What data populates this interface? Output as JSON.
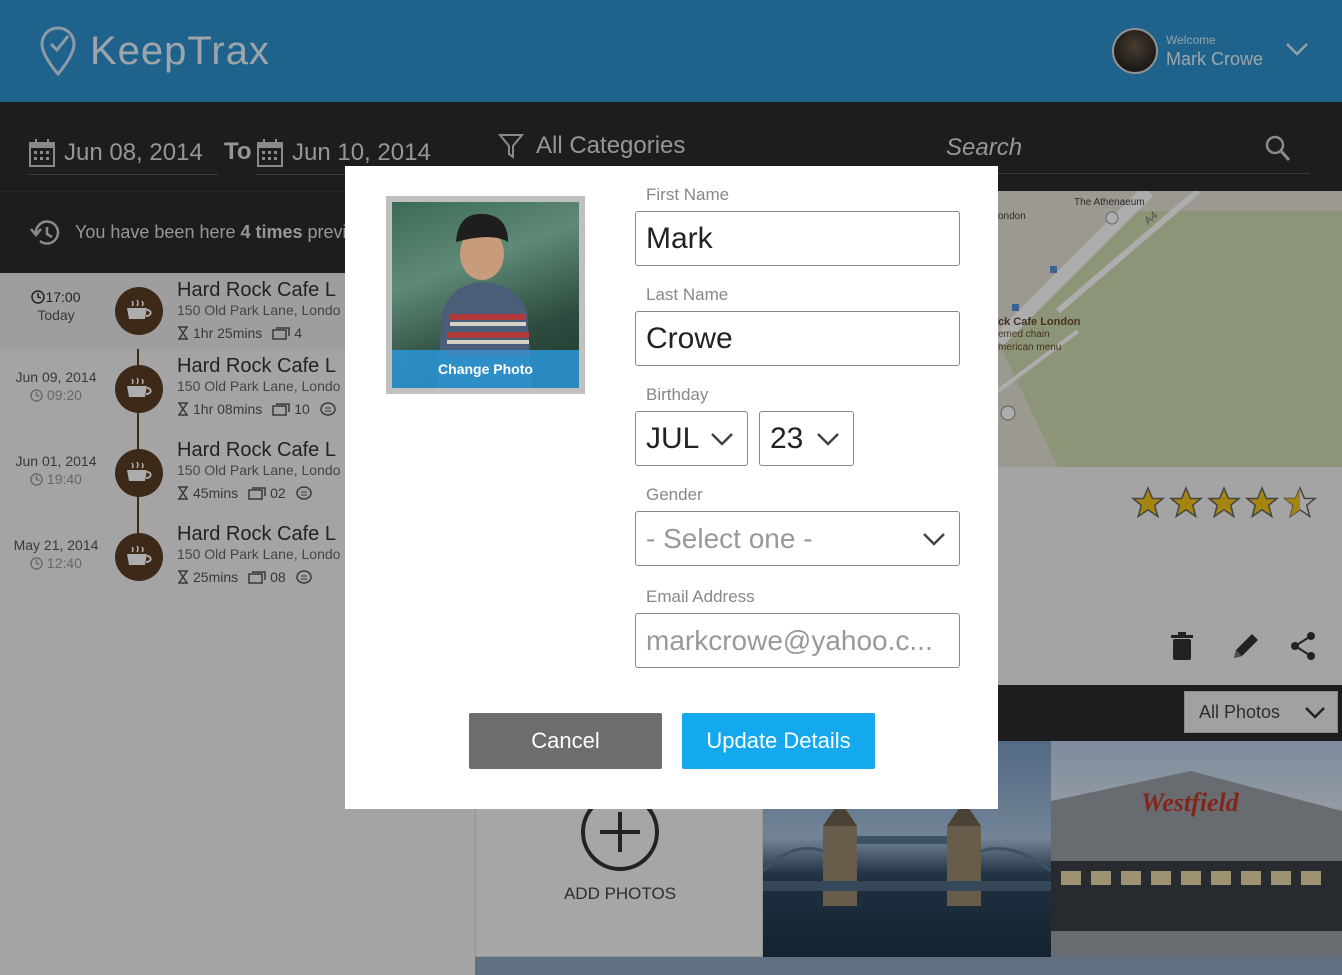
{
  "app": {
    "name": "KeepTrax"
  },
  "user": {
    "welcome": "Welcome",
    "name": "Mark Crowe"
  },
  "filters": {
    "from_date": "Jun 08, 2014",
    "to_label": "To",
    "to_date": "Jun 10, 2014",
    "category": "All Categories",
    "search_placeholder": "Search"
  },
  "visited": {
    "prefix": "You have been here ",
    "count": "4 times",
    "suffix": " previ"
  },
  "places": [
    {
      "date": "17:00",
      "time": "Today",
      "name": "Hard Rock Cafe L",
      "address": "150 Old Park Lane, Londo",
      "duration": "1hr 25mins",
      "photos": "4"
    },
    {
      "date": "Jun 09, 2014",
      "time": "09:20",
      "name": "Hard Rock Cafe L",
      "address": "150 Old Park Lane, Londo",
      "duration": "1hr 08mins",
      "photos": "10"
    },
    {
      "date": "Jun 01, 2014",
      "time": "19:40",
      "name": "Hard Rock Cafe L",
      "address": "150 Old Park Lane, Londo",
      "duration": "45mins",
      "photos": "02"
    },
    {
      "date": "May 21, 2014",
      "time": "12:40",
      "name": "Hard Rock Cafe L",
      "address": "150 Old Park Lane, Londo",
      "duration": "25mins",
      "photos": "08"
    }
  ],
  "map": {
    "labels": {
      "athenaeum": "The Athenaeum",
      "london": "ondon",
      "cafe": "ck Cafe London",
      "chain": "emed chain",
      "menu": "merican menu",
      "road": "A4"
    }
  },
  "rating": {
    "value": 4.5,
    "max": 5
  },
  "photos": {
    "filter": "All Photos",
    "add_label": "ADD PHOTOS",
    "tiles": [
      "tower-bridge",
      "westfield"
    ],
    "westfield_text": "Westfield"
  },
  "modal": {
    "change_photo": "Change Photo",
    "first_name_label": "First Name",
    "first_name": "Mark",
    "last_name_label": "Last Name",
    "last_name": "Crowe",
    "birthday_label": "Birthday",
    "birthday_month": "JUL",
    "birthday_day": "23",
    "gender_label": "Gender",
    "gender_placeholder": "- Select one -",
    "email_label": "Email Address",
    "email_placeholder": "markcrowe@yahoo.c...",
    "cancel": "Cancel",
    "update": "Update Details"
  },
  "colors": {
    "header": "#2f93d0",
    "dark_bar": "#2b2b2b",
    "accent": "#14a9ef",
    "badge": "#5a3d22",
    "star": "#f0c419"
  }
}
